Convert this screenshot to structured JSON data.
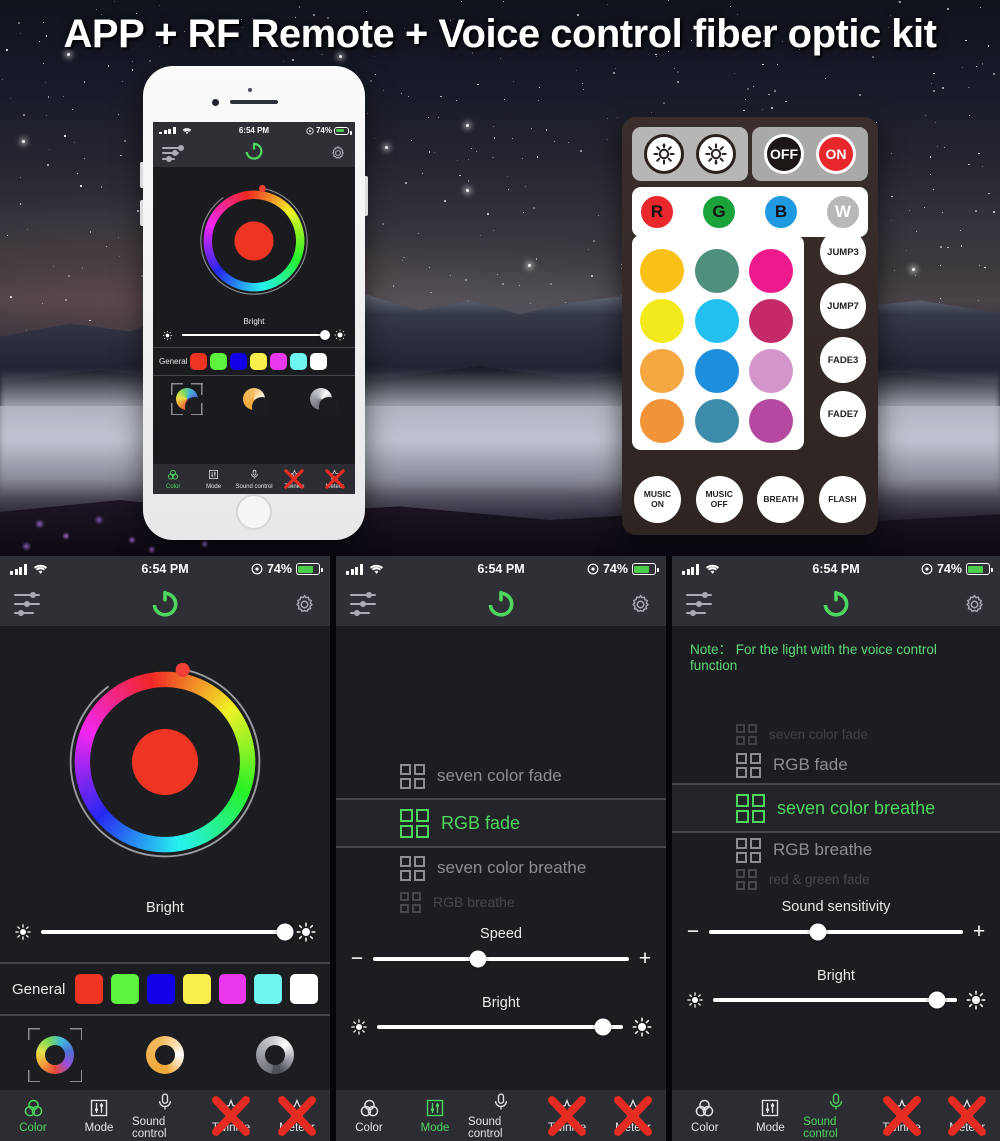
{
  "hero": {
    "title": "APP + RF Remote + Voice control fiber optic kit"
  },
  "remote": {
    "top_buttons": [
      {
        "name": "brightness-up",
        "label": "",
        "icon": "sun-up-icon"
      },
      {
        "name": "brightness-down",
        "label": "",
        "icon": "sun-down-icon"
      },
      {
        "name": "off",
        "label": "OFF"
      },
      {
        "name": "on",
        "label": "ON"
      }
    ],
    "rgbw": [
      {
        "label": "R",
        "color": "#e8282c",
        "ring": "#ffffff"
      },
      {
        "label": "G",
        "color": "#1aa33a",
        "ring": "#ffffff"
      },
      {
        "label": "B",
        "color": "#1f9ae0",
        "ring": "#ffffff"
      },
      {
        "label": "W",
        "color": "#b8b8b8",
        "ring": "#ffffff"
      }
    ],
    "color_grid": [
      "#f9c018",
      "#4e8f7e",
      "#ec1a8c",
      "#f2ea1c",
      "#22c0ee",
      "#c42a68",
      "#f5a742",
      "#1e8ede",
      "#d495cb",
      "#f09339",
      "#3e8cab",
      "#b548a0"
    ],
    "side_buttons": [
      "JUMP3",
      "JUMP7",
      "FADE3",
      "FADE7"
    ],
    "bottom_buttons": [
      {
        "line1": "MUSIC",
        "line2": "ON"
      },
      {
        "line1": "MUSIC",
        "line2": "OFF"
      },
      {
        "line1": "BREATH",
        "line2": ""
      },
      {
        "line1": "FLASH",
        "line2": ""
      }
    ]
  },
  "status": {
    "time": "6:54 PM",
    "battery_percent": "74%"
  },
  "tabs": [
    {
      "label": "Color",
      "icon": "color-rings-icon"
    },
    {
      "label": "Mode",
      "icon": "sliders-icon"
    },
    {
      "label": "Sound control",
      "icon": "microphone-icon"
    },
    {
      "label": "Twinkle",
      "icon": "twinkle-icon",
      "disabled": true
    },
    {
      "label": "Meteor",
      "icon": "meteor-icon",
      "disabled": true
    }
  ],
  "panel1": {
    "active_tab": "Color",
    "selected_color": "#ee3524",
    "bright": {
      "label": "Bright",
      "value": 100
    },
    "general": {
      "label": "General",
      "swatches": [
        "#ee3524",
        "#5cf23d",
        "#1100e8",
        "#f8ef4e",
        "#ec38ec",
        "#6ef5f0",
        "#ffffff"
      ]
    },
    "presets": [
      {
        "name": "rgb-ring-preset",
        "selected": true
      },
      {
        "name": "warm-white-ring-preset",
        "selected": false
      },
      {
        "name": "cool-white-ring-preset",
        "selected": false
      }
    ]
  },
  "panel2": {
    "active_tab": "Mode",
    "modes": [
      {
        "label": "seven color fade",
        "state": "dim"
      },
      {
        "label": "RGB fade",
        "state": "selected"
      },
      {
        "label": "seven color breathe",
        "state": "dim"
      },
      {
        "label": "RGB breathe",
        "state": "faint"
      }
    ],
    "speed": {
      "label": "Speed",
      "value": 40
    },
    "bright": {
      "label": "Bright",
      "value": 92
    }
  },
  "panel3": {
    "active_tab": "Sound control",
    "note": "Note： For the light with the voice control function",
    "modes": [
      {
        "label": "seven color fade",
        "state": "faint"
      },
      {
        "label": "RGB fade",
        "state": "dim"
      },
      {
        "label": "seven color breathe",
        "state": "selected"
      },
      {
        "label": "RGB breathe",
        "state": "dim"
      },
      {
        "label": "red & green fade",
        "state": "faint"
      }
    ],
    "sensitivity": {
      "label": "Sound sensitivity",
      "value": 42
    },
    "bright": {
      "label": "Bright",
      "value": 92
    }
  },
  "colors": {
    "accent_green": "#4ed65f",
    "panel_bg": "#1c1d21",
    "bar_bg": "#2e3036",
    "tabbar_bg": "#2b2d33",
    "disabled_red": "#e52b22"
  }
}
